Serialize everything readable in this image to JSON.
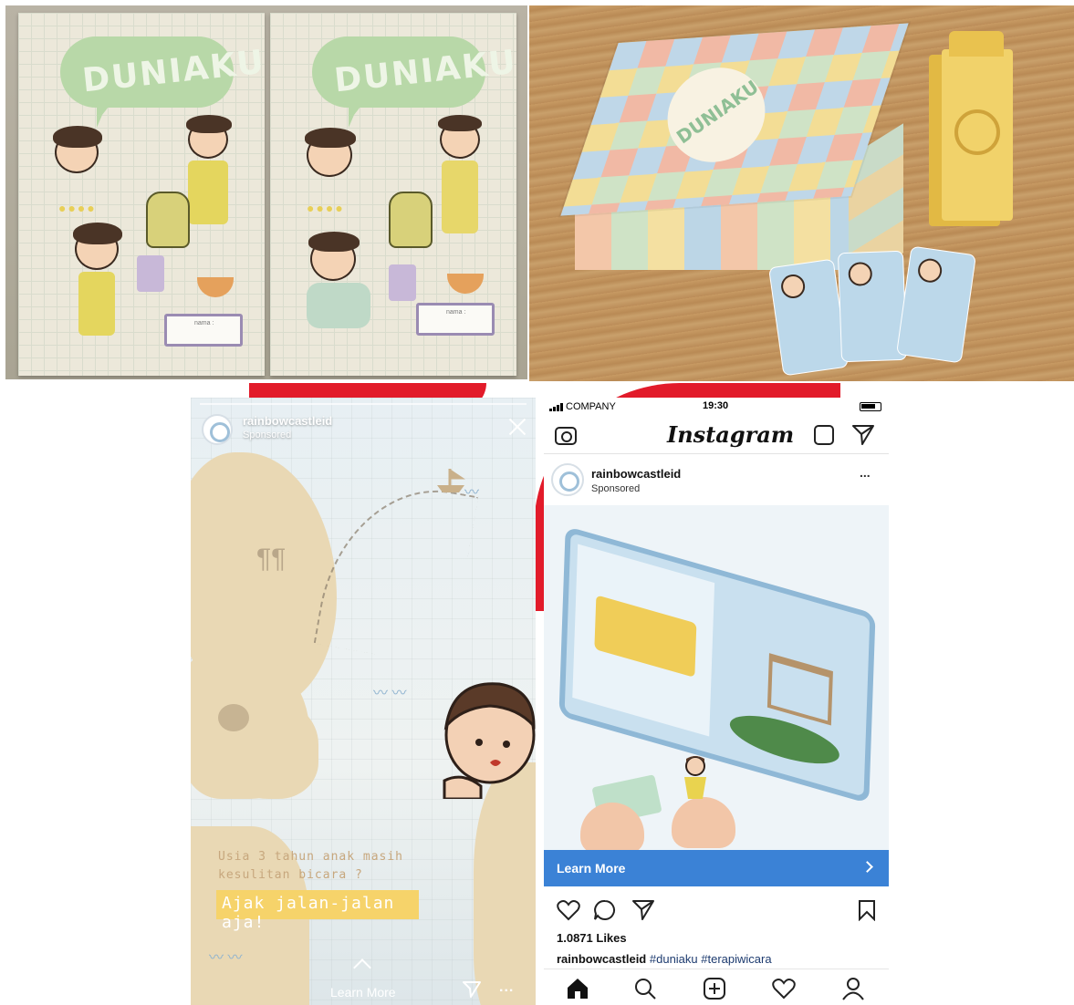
{
  "sticker_photo": {
    "logo_text": "DUNIAKU"
  },
  "box_photo": {
    "logo_text": "DUNIAKU"
  },
  "story_ad": {
    "username": "rainbowcastleid",
    "sponsored": "Sponsored",
    "question_line1": "Usia 3 tahun anak masih",
    "question_line2": "kesulitan bicara ?",
    "cta_text": "Ajak jalan-jalan aja!",
    "learn_more": "Learn More",
    "more_label": "..."
  },
  "instagram": {
    "status": {
      "carrier": "COMPANY",
      "time": "19:30"
    },
    "logo": "Instagram",
    "post": {
      "username": "rainbowcastleid",
      "sponsored": "Sponsored",
      "more": "...",
      "learn_more": "Learn More",
      "likes": "1.0871 Likes",
      "caption_user": "rainbowcastleid",
      "caption_tags": "#duniaku #terapiwicara"
    }
  },
  "colors": {
    "red_bg": "#e21b2a",
    "learn_blue": "#3b82d6",
    "cta_yellow": "#f6d36a"
  }
}
